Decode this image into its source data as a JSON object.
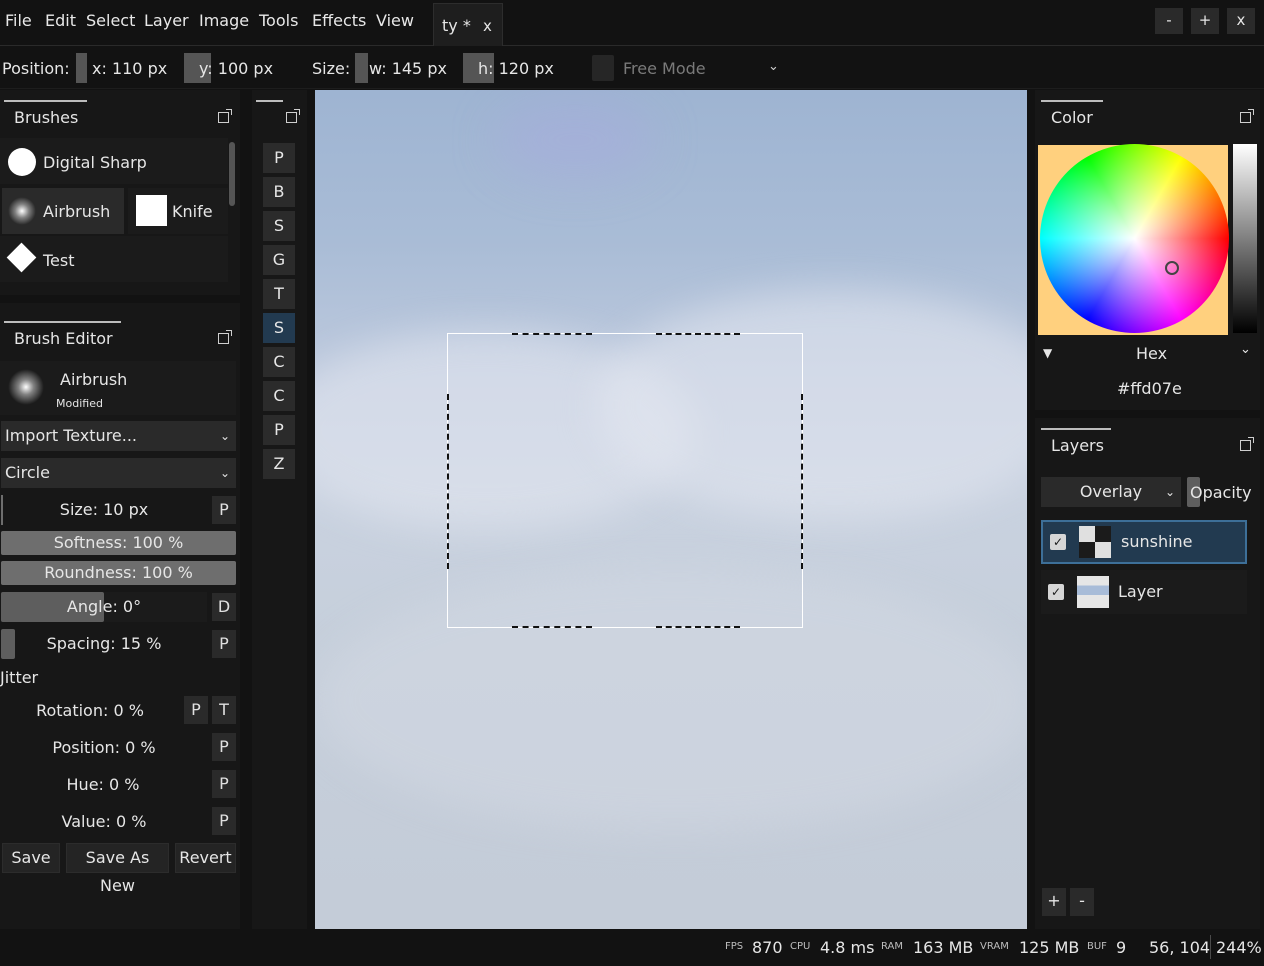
{
  "menu": {
    "file": "File",
    "edit": "Edit",
    "select": "Select",
    "layer": "Layer",
    "image": "Image",
    "tools": "Tools",
    "effects": "Effects",
    "view": "View"
  },
  "tab": {
    "title": "ty *",
    "close": "x"
  },
  "window": {
    "minimize": "-",
    "maximize": "+",
    "close": "x"
  },
  "toolbar": {
    "position_label": "Position:",
    "x_value": "x: 110 px",
    "y_value": "y: 100 px",
    "size_label": "Size:",
    "w_value": "w: 145 px",
    "h_value": "h: 120 px",
    "free_mode": "Free Mode"
  },
  "brushes": {
    "title": "Brushes",
    "items": [
      "Digital Sharp",
      "Airbrush",
      "Knife",
      "Test"
    ]
  },
  "brush_editor": {
    "title": "Brush Editor",
    "name": "Airbrush",
    "modified": "Modified",
    "import_texture": "Import Texture...",
    "shape": "Circle",
    "size": "Size: 10 px",
    "softness": "Softness: 100 %",
    "roundness": "Roundness: 100 %",
    "angle": "Angle: 0°",
    "spacing": "Spacing: 15 %",
    "jitter": "Jitter",
    "rotation": "Rotation: 0 %",
    "position": "Position: 0 %",
    "hue": "Hue: 0 %",
    "value": "Value: 0 %",
    "save": "Save",
    "save_as_new": "Save As New",
    "revert": "Revert",
    "pbtn": "P",
    "dbtn": "D",
    "tbtn": "T",
    "softness_level": 1.0,
    "roundness_level": 1.0,
    "angle_level": 0.44,
    "size_level": 0.0,
    "spacing_level": 0.06
  },
  "tools": [
    "P",
    "B",
    "S",
    "G",
    "T",
    "S",
    "C",
    "C",
    "P",
    "Z"
  ],
  "active_tool_index": 5,
  "color": {
    "title": "Color",
    "mode": "Hex",
    "hex": "#ffd07e"
  },
  "layers": {
    "title": "Layers",
    "blend": "Overlay",
    "opacity": "Opacity",
    "items": [
      {
        "name": "sunshine",
        "selected": true
      },
      {
        "name": "Layer",
        "selected": false
      }
    ],
    "add": "+",
    "remove": "-"
  },
  "status": {
    "fps_label": "FPS",
    "fps": "870",
    "cpu_label": "CPU",
    "cpu": "4.8 ms",
    "ram_label": "RAM",
    "ram": "163 MB",
    "vram_label": "VRAM",
    "vram": "125 MB",
    "buf_label": "BUF",
    "buf": "9",
    "coords": "56, 104",
    "zoom": "244%"
  },
  "colors": {
    "accent": "#223a50",
    "selected_layer_border": "#3d6f98",
    "selection": "#ffffff"
  }
}
